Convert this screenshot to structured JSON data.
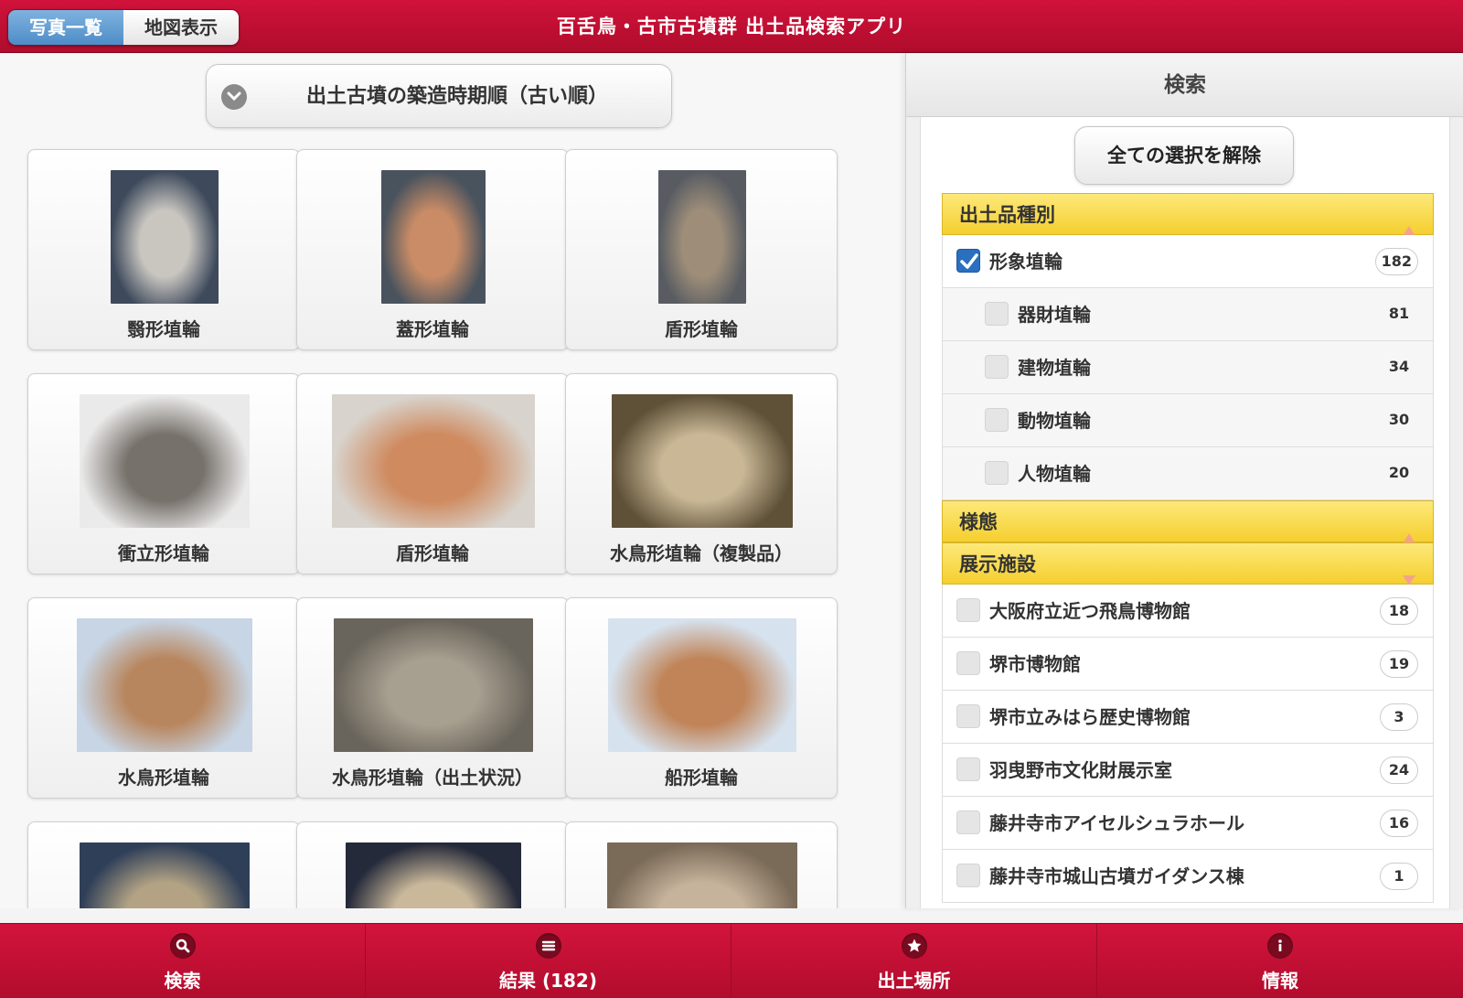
{
  "header": {
    "title": "百舌鳥・古市古墳群 出土品検索アプリ",
    "view_toggle": [
      {
        "label": "写真一覧",
        "active": true
      },
      {
        "label": "地図表示",
        "active": false
      }
    ]
  },
  "sort": {
    "label": "出土古墳の築造時期順（古い順）",
    "icon": "chevron-down-icon"
  },
  "results": [
    {
      "caption": "翳形埴輪",
      "thumb_colors": [
        "#3e4a5c",
        "#c9c6c0"
      ]
    },
    {
      "caption": "蓋形埴輪",
      "thumb_colors": [
        "#49535e",
        "#c98c66"
      ]
    },
    {
      "caption": "盾形埴輪",
      "thumb_colors": [
        "#585c62",
        "#9e8e79"
      ]
    },
    {
      "caption": "衝立形埴輪",
      "thumb_colors": [
        "#eaeaea",
        "#77716b"
      ]
    },
    {
      "caption": "盾形埴輪",
      "thumb_colors": [
        "#d8d3cc",
        "#cf8a5f"
      ]
    },
    {
      "caption": "水鳥形埴輪（複製品）",
      "thumb_colors": [
        "#5e5138",
        "#c9b796"
      ]
    },
    {
      "caption": "水鳥形埴輪",
      "thumb_colors": [
        "#c7d5e4",
        "#b8865e"
      ]
    },
    {
      "caption": "水鳥形埴輪（出土状況）",
      "thumb_colors": [
        "#6a655c",
        "#a79f8f"
      ]
    },
    {
      "caption": "船形埴輪",
      "thumb_colors": [
        "#d6e2ee",
        "#c08458"
      ]
    },
    {
      "caption": "",
      "thumb_colors": [
        "#2f3f58",
        "#b3a384"
      ]
    },
    {
      "caption": "",
      "thumb_colors": [
        "#252a3a",
        "#c9b89a"
      ]
    },
    {
      "caption": "",
      "thumb_colors": [
        "#7a6a58",
        "#c5b39b"
      ]
    }
  ],
  "search": {
    "title": "検索",
    "clear_label": "全ての選択を解除",
    "sections": [
      {
        "label": "出土品種別",
        "indicator": "up",
        "items": [
          {
            "label": "形象埴輪",
            "count": "182",
            "checked": true,
            "sub": false
          },
          {
            "label": "器財埴輪",
            "count": "81",
            "checked": false,
            "sub": true
          },
          {
            "label": "建物埴輪",
            "count": "34",
            "checked": false,
            "sub": true
          },
          {
            "label": "動物埴輪",
            "count": "30",
            "checked": false,
            "sub": true
          },
          {
            "label": "人物埴輪",
            "count": "20",
            "checked": false,
            "sub": true
          }
        ]
      },
      {
        "label": "様態",
        "indicator": "up",
        "items": []
      },
      {
        "label": "展示施設",
        "indicator": "down",
        "items": [
          {
            "label": "大阪府立近つ飛鳥博物館",
            "count": "18",
            "checked": false,
            "sub": false
          },
          {
            "label": "堺市博物館",
            "count": "19",
            "checked": false,
            "sub": false
          },
          {
            "label": "堺市立みはら歴史博物館",
            "count": "3",
            "checked": false,
            "sub": false
          },
          {
            "label": "羽曳野市文化財展示室",
            "count": "24",
            "checked": false,
            "sub": false
          },
          {
            "label": "藤井寺市アイセルシュラホール",
            "count": "16",
            "checked": false,
            "sub": false
          },
          {
            "label": "藤井寺市城山古墳ガイダンス棟",
            "count": "1",
            "checked": false,
            "sub": false
          }
        ]
      }
    ]
  },
  "tabbar": [
    {
      "label": "検索",
      "icon": "search-icon"
    },
    {
      "label": "結果 (182)",
      "icon": "list-icon"
    },
    {
      "label": "出土場所",
      "icon": "star-icon"
    },
    {
      "label": "情報",
      "icon": "info-icon"
    }
  ],
  "colors": {
    "brand_red": "#c8103a",
    "section_yellow": "#f7d646",
    "active_blue": "#5a97d0",
    "check_blue": "#2a6fc0"
  }
}
